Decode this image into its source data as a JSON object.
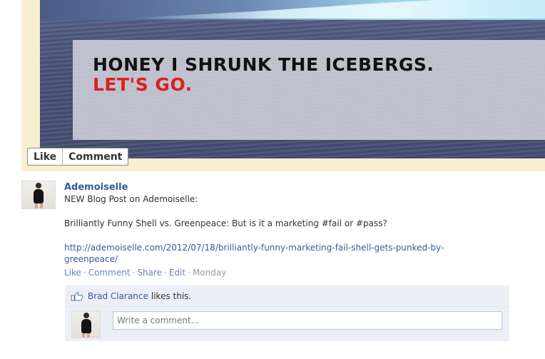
{
  "photo": {
    "headline_1": "HONEY I SHRUNK THE ICEBERGS.",
    "headline_2": "LET'S GO.",
    "actions": {
      "like": "Like",
      "comment": "Comment"
    }
  },
  "post": {
    "author": "Ademoiselle",
    "line1": "NEW Blog Post on Ademoiselle:",
    "line2": "Brilliantly Funny Shell vs. Greenpeace: But is it a marketing #fail or #pass?",
    "link": "http://ademoiselle.com/2012/07/18/brilliantly-funny-marketing-fail-shell-gets-punked-by-greenpeace/",
    "meta": {
      "like": "Like",
      "comment": "Comment",
      "share": "Share",
      "edit": "Edit",
      "time": "Monday",
      "separator": "·"
    }
  },
  "ufi": {
    "liker": "Brad Clarance",
    "likes_text": "likes this.",
    "comment_placeholder": "Write a comment..."
  },
  "colors": {
    "link_blue": "#3b5998",
    "meta_blue": "#6d84b4",
    "headline_red": "#d9201d",
    "ufi_bg": "#eceff5"
  }
}
